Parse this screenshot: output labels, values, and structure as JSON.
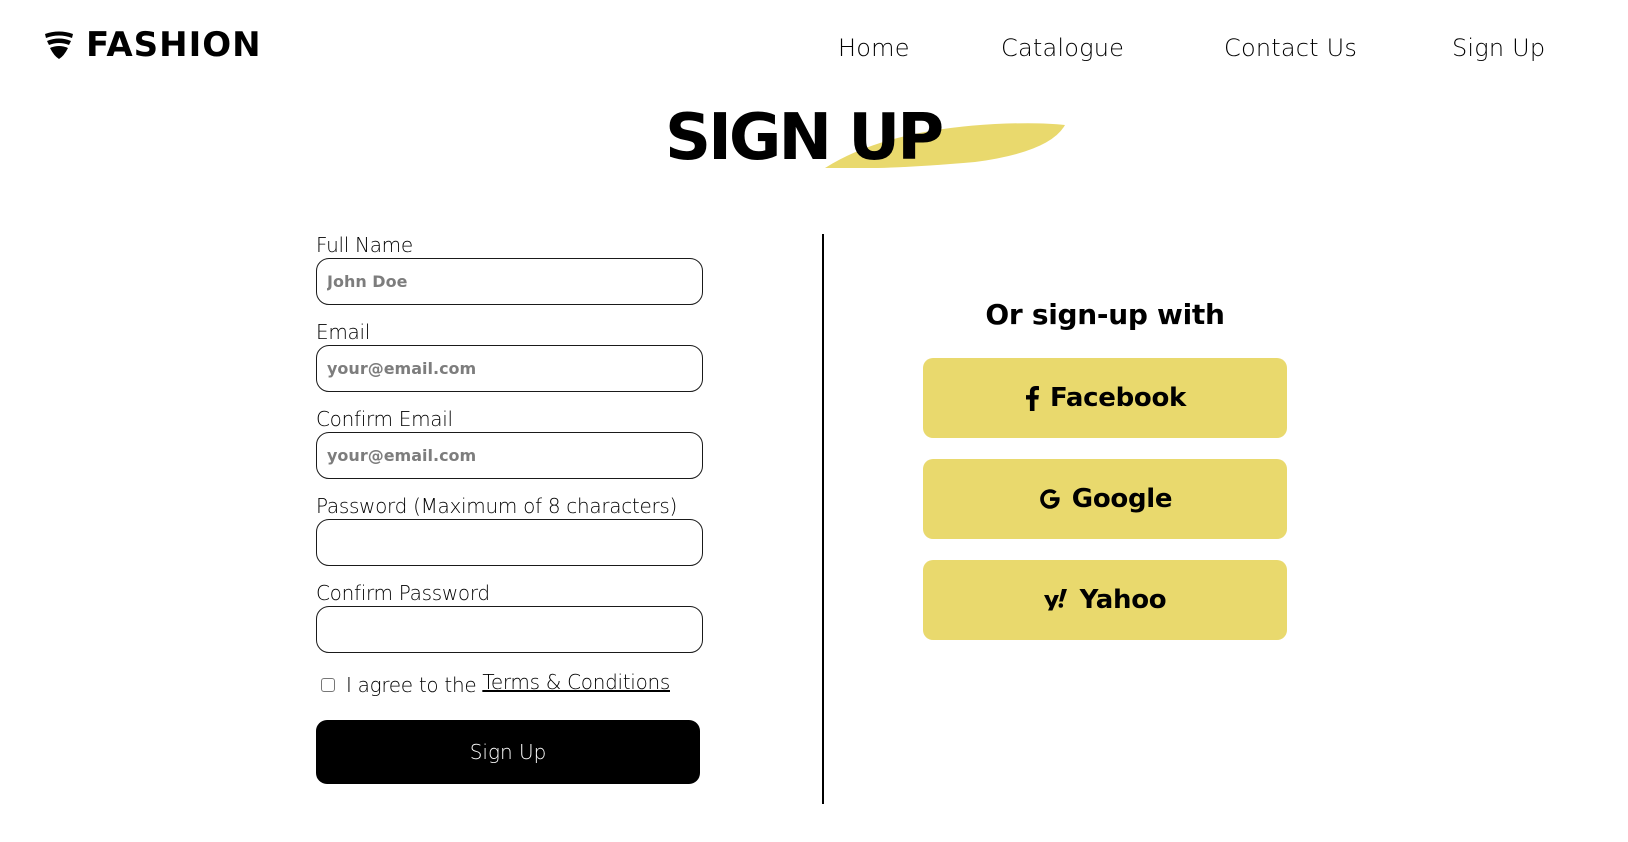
{
  "brand": {
    "name": "FASHION",
    "icon": "shield-wifi-icon"
  },
  "nav": {
    "items": [
      {
        "label": "Home"
      },
      {
        "label": "Catalogue"
      },
      {
        "label": "Contact Us"
      },
      {
        "label": "Sign Up"
      }
    ]
  },
  "page": {
    "title": "SIGN UP",
    "accent_color": "#e9d96d"
  },
  "form": {
    "fields": [
      {
        "label": "Full Name",
        "placeholder": "John Doe",
        "value": "",
        "type": "text"
      },
      {
        "label": "Email",
        "placeholder": "your@email.com",
        "value": "",
        "type": "email"
      },
      {
        "label": "Confirm Email",
        "placeholder": "your@email.com",
        "value": "",
        "type": "email"
      },
      {
        "label": "Password (Maximum of 8 characters)",
        "placeholder": "",
        "value": "",
        "type": "password"
      },
      {
        "label": "Confirm Password",
        "placeholder": "",
        "value": "",
        "type": "password"
      }
    ],
    "agree_text": "I agree to the",
    "terms_link": "Terms & Conditions",
    "agree_checked": false,
    "submit_label": "Sign Up"
  },
  "social": {
    "heading": "Or sign-up with",
    "buttons": [
      {
        "label": "Facebook",
        "icon": "facebook-icon"
      },
      {
        "label": "Google",
        "icon": "google-icon"
      },
      {
        "label": "Yahoo",
        "icon": "yahoo-icon"
      }
    ],
    "button_color": "#e9d96d"
  }
}
